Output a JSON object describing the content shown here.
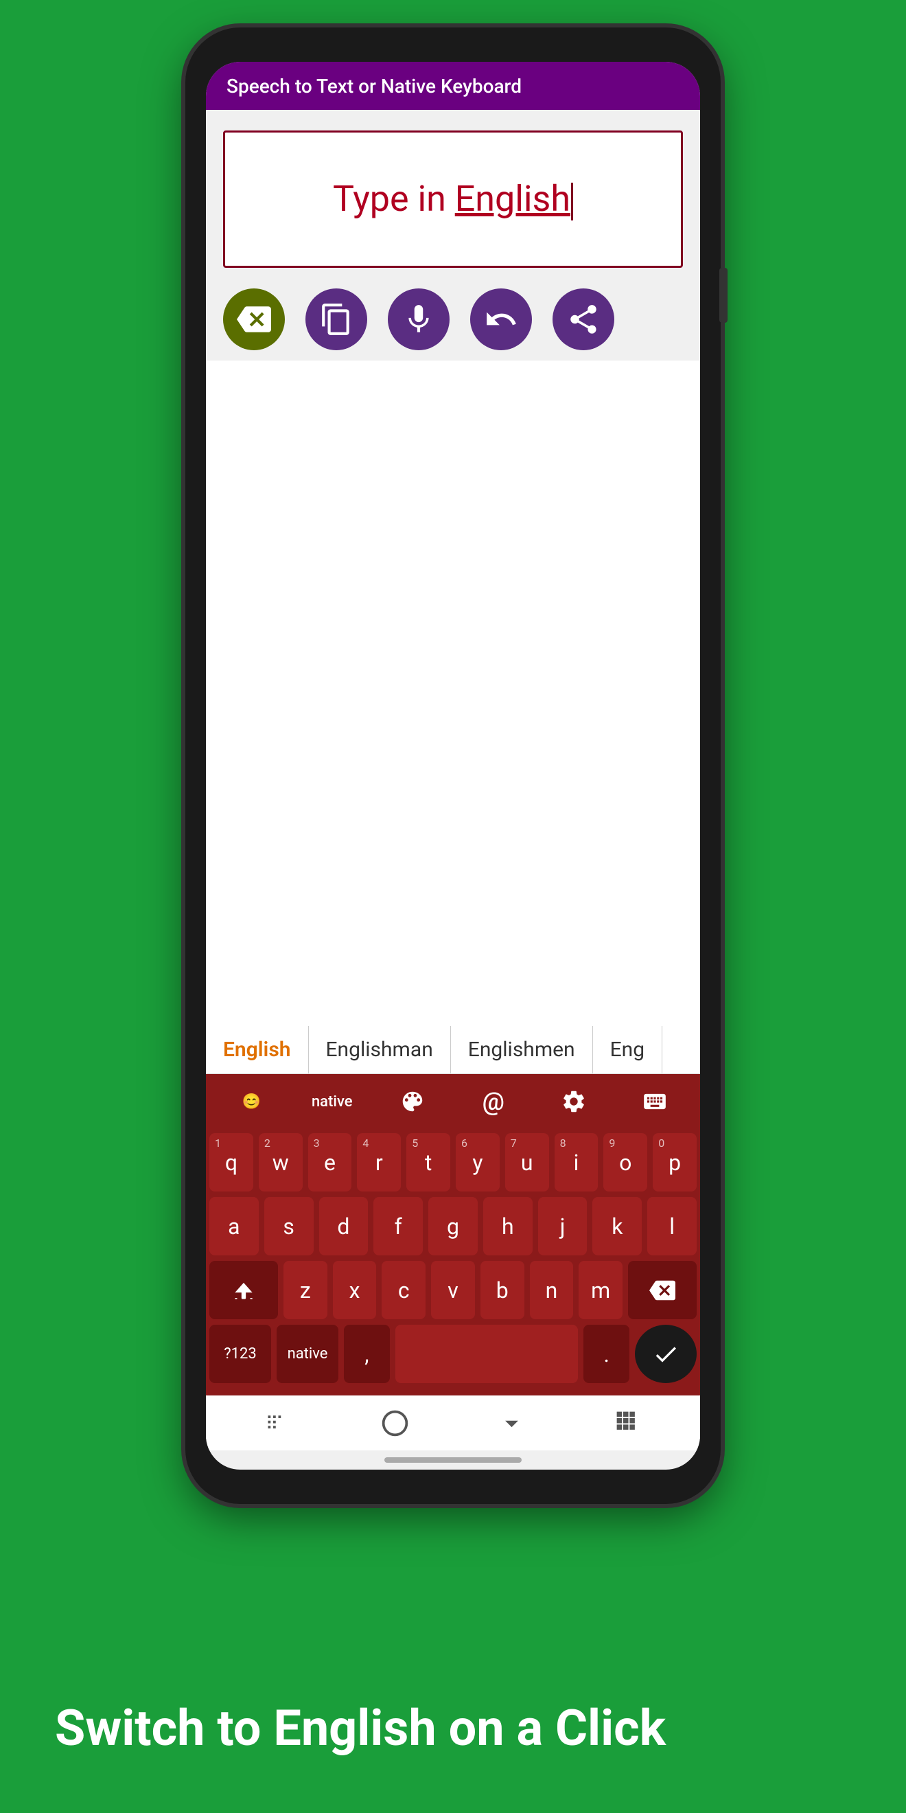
{
  "app": {
    "top_bar_title": "Speech to Text or Native Keyboard"
  },
  "text_input": {
    "content_prefix": "Type in ",
    "content_word": "English",
    "placeholder": "Type in English"
  },
  "suggestions": [
    {
      "label": "English",
      "active": true
    },
    {
      "label": "Englishman",
      "active": false
    },
    {
      "label": "Englishmen",
      "active": false
    },
    {
      "label": "Eng",
      "active": false
    }
  ],
  "toolbar": {
    "emoji_icon": "😊",
    "native_label": "native",
    "palette_label": "palette",
    "at_label": "@",
    "settings_label": "settings",
    "keyboard_label": "keyboard"
  },
  "keyboard": {
    "rows": [
      [
        "q",
        "w",
        "e",
        "r",
        "t",
        "y",
        "u",
        "i",
        "o",
        "p"
      ],
      [
        "a",
        "s",
        "d",
        "f",
        "g",
        "h",
        "j",
        "k",
        "l"
      ],
      [
        "z",
        "x",
        "c",
        "v",
        "b",
        "n",
        "m"
      ]
    ],
    "numbers": [
      "1",
      "2",
      "3",
      "4",
      "5",
      "6",
      "7",
      "8",
      "9",
      "0"
    ],
    "bottom_row": {
      "numbers_label": "?123",
      "native_label": "native",
      "comma": ",",
      "space": "",
      "period": "."
    }
  },
  "nav_bar": {
    "back_icon": "|||",
    "home_icon": "○",
    "down_icon": "⌄",
    "grid_icon": "⠿"
  },
  "bottom_text": {
    "headline": "Switch to English on a Click"
  }
}
